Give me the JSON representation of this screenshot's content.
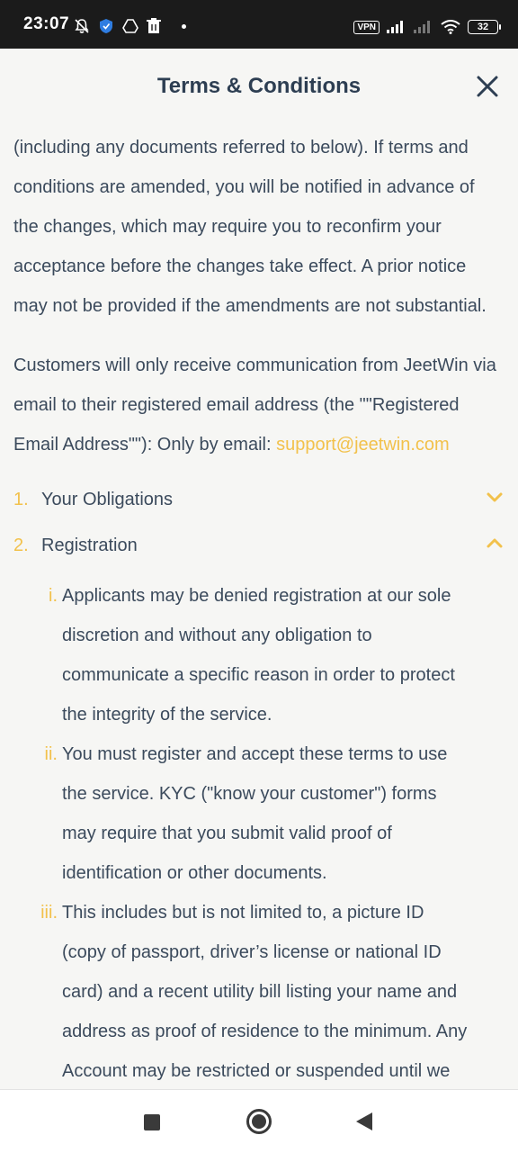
{
  "status_bar": {
    "time": "23:07",
    "vpn": "VPN",
    "battery": "32",
    "icons_left": [
      "bell-off-icon",
      "shield-icon",
      "drive-icon",
      "trash-icon",
      "dot-icon"
    ],
    "icons_right": [
      "vpn-badge",
      "signal-icon",
      "signal-weak-icon",
      "wifi-icon",
      "battery-icon"
    ]
  },
  "header": {
    "title": "Terms & Conditions",
    "close_icon": "close-icon"
  },
  "content": {
    "intro_lines": [
      "(including any documents referred to below). If terms and",
      "conditions are amended, you will be notified in advance of",
      "the changes, which may require you to reconfirm your",
      "acceptance before the changes take effect. A prior notice",
      "may not be provided if the amendments are not substantial."
    ],
    "communication_lines": [
      "Customers will only receive communication from JeetWin via",
      "email to their registered email address (the \"\"Registered"
    ],
    "communication_last_prefix": "Email Address\"\"): Only by email: ",
    "support_email": "support@jeetwin.com",
    "accordion": [
      {
        "number": "1.",
        "label": "Your Obligations",
        "state": "collapsed"
      },
      {
        "number": "2.",
        "label": "Registration",
        "state": "expanded"
      }
    ],
    "registration_items": [
      {
        "numeral": "i.",
        "lines": [
          "Applicants may be denied registration at our sole",
          "discretion and without any obligation to",
          "communicate a specific reason in order to protect",
          "the integrity of the service."
        ]
      },
      {
        "numeral": "ii.",
        "lines": [
          "You must register and accept these terms to use",
          "the service. KYC (\"know your customer\") forms",
          "may require that you submit valid proof of",
          "identification or other documents."
        ]
      },
      {
        "numeral": "iii.",
        "lines": [
          "This includes but is not limited to, a picture ID",
          "(copy of passport, driver’s license or national ID",
          "card) and a recent utility bill listing your name and",
          "address as proof of residence to the minimum. Any",
          "Account may be restricted or suspended until we"
        ]
      }
    ]
  },
  "colors": {
    "accent": "#f2c14b",
    "text": "#3b4a5c",
    "title": "#2d3e52",
    "background": "#f6f6f4"
  },
  "nav_bar": {
    "icons": [
      "recents-icon",
      "home-icon",
      "back-icon"
    ]
  }
}
